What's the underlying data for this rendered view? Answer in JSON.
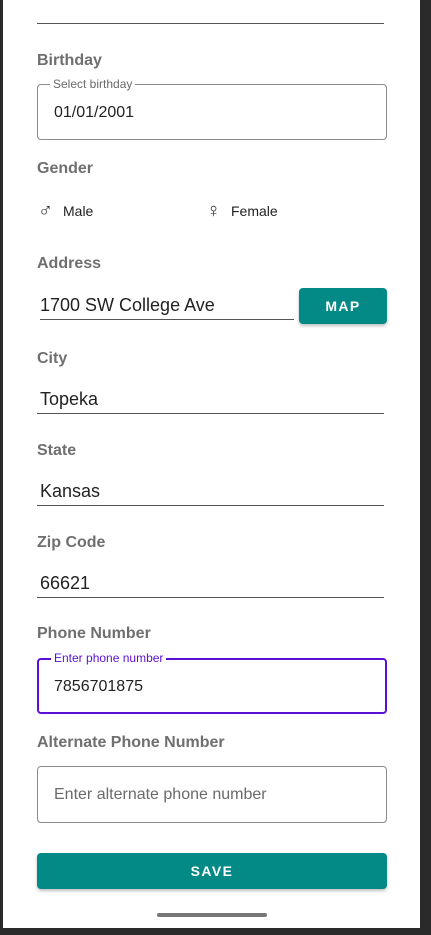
{
  "birthday": {
    "label": "Birthday",
    "float_label": "Select birthday",
    "value": "01/01/2001"
  },
  "gender": {
    "label": "Gender",
    "options": [
      {
        "label": "Male",
        "icon": "male-icon"
      },
      {
        "label": "Female",
        "icon": "female-icon"
      }
    ]
  },
  "address": {
    "label": "Address",
    "value": "1700 SW College Ave",
    "map_button": "MAP"
  },
  "city": {
    "label": "City",
    "value": "Topeka"
  },
  "state": {
    "label": "State",
    "value": "Kansas"
  },
  "zip": {
    "label": "Zip Code",
    "value": "66621"
  },
  "phone": {
    "label": "Phone Number",
    "float_label": "Enter phone number",
    "value": "7856701875"
  },
  "alt_phone": {
    "label": "Alternate Phone Number",
    "placeholder": "Enter alternate phone number"
  },
  "save_button": "SAVE",
  "colors": {
    "accent": "#048a86",
    "focus": "#5b0fd6"
  }
}
